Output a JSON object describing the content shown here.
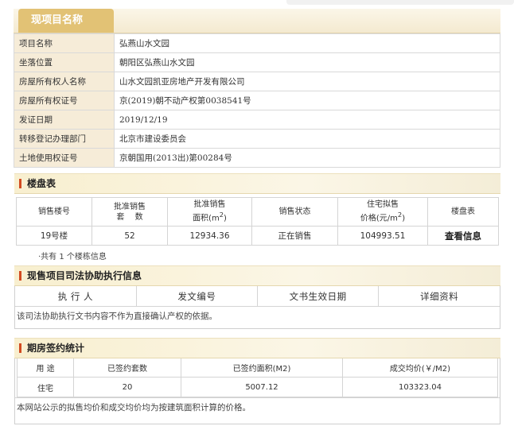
{
  "project": {
    "tab_title": "现项目名称",
    "rows": [
      {
        "label": "项目名称",
        "value": "弘燕山水文园"
      },
      {
        "label": "坐落位置",
        "value": "朝阳区弘燕山水文园"
      },
      {
        "label": "房屋所有权人名称",
        "value": "山水文园凯亚房地产开发有限公司"
      },
      {
        "label": "房屋所有权证号",
        "value": "京(2019)朝不动产权第0038541号"
      },
      {
        "label": "发证日期",
        "value": "2019/12/19"
      },
      {
        "label": "转移登记办理部门",
        "value": "北京市建设委员会"
      },
      {
        "label": "土地使用权证号",
        "value": "京朝国用(2013出)第00284号"
      }
    ]
  },
  "buildings": {
    "title": "楼盘表",
    "headers": {
      "h0": "销售楼号",
      "h1a": "批准销售",
      "h1b": "套　 数",
      "h2a": "批准销售",
      "h2b": "面积(m",
      "h2sup": "2",
      "h2c": ")",
      "h3": "销售状态",
      "h4a": "住宅拟售",
      "h4b": "价格(元/m",
      "h4sup": "2",
      "h4c": ")",
      "h5": "楼盘表"
    },
    "row": {
      "building": "19号楼",
      "units": "52",
      "area": "12934.36",
      "status": "正在销售",
      "price": "104993.51",
      "action": "查看信息"
    },
    "note": "·共有 1 个楼栋信息"
  },
  "judicial": {
    "title": "现售项目司法协助执行信息",
    "headers": [
      "执 行 人",
      "发文编号",
      "文书生效日期",
      "详细资料"
    ],
    "text": "该司法协助执行文书内容不作为直接确认产权的依据。"
  },
  "signing": {
    "title": "期房签约统计",
    "headers": [
      "用 途",
      "已签约套数",
      "已签约面积(M2)",
      "成交均价(￥/M2)"
    ],
    "row": [
      "住宅",
      "20",
      "5007.12",
      "103323.04"
    ],
    "text": "本网站公示的拟售均价和成交均价均为按建筑面积计算的价格。"
  },
  "colors": {
    "tab": "#e2c275",
    "label_bg": "#f6ecd8",
    "accent_bar": "#d24a20"
  }
}
